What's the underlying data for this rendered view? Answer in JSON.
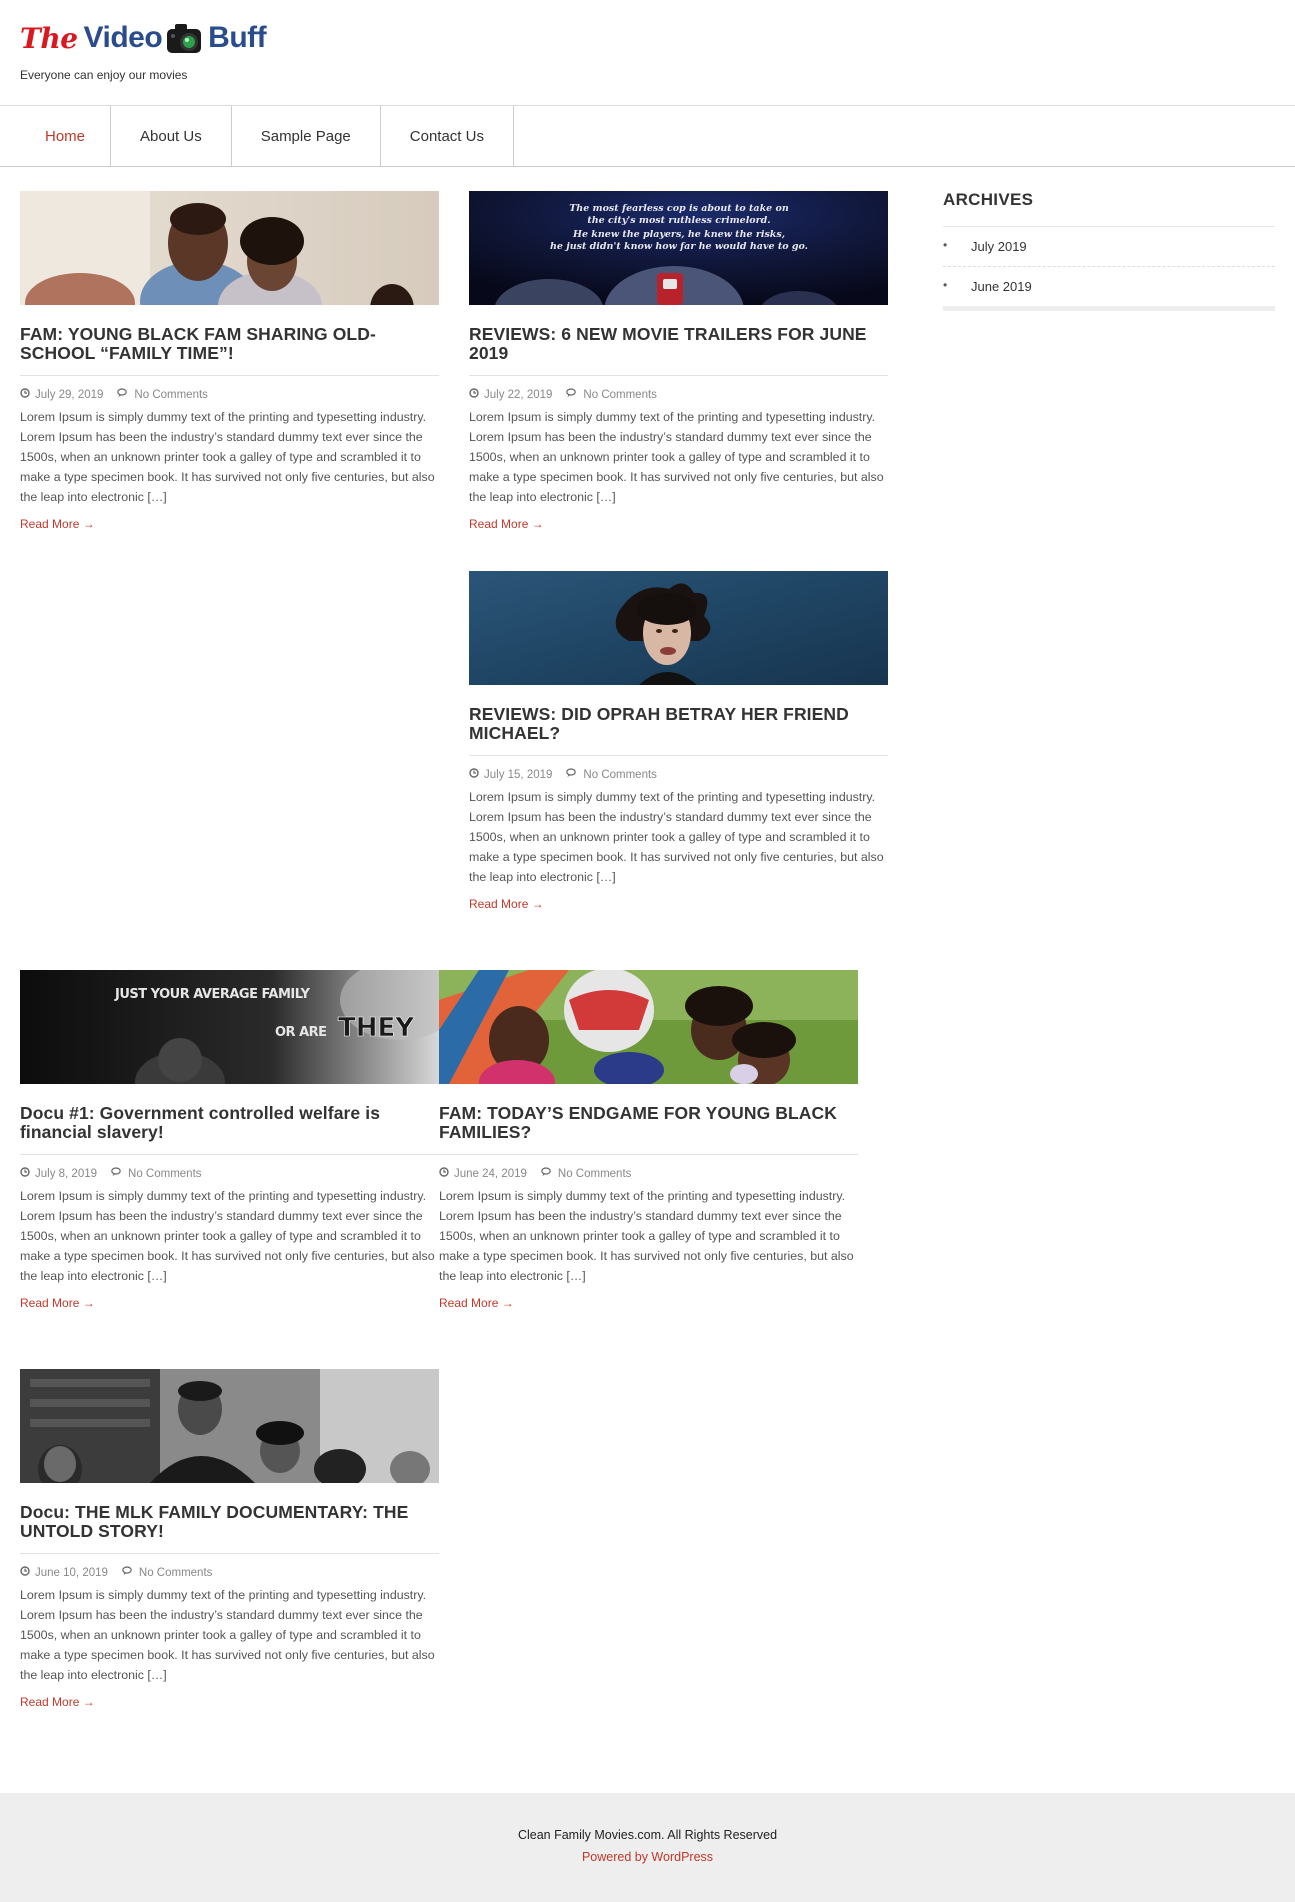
{
  "site": {
    "logo_the": "The",
    "logo_video": "Video",
    "logo_buff": "Buff",
    "tagline": "Everyone can enjoy our movies"
  },
  "nav": {
    "items": [
      {
        "label": "Home"
      },
      {
        "label": "About Us"
      },
      {
        "label": "Sample Page"
      },
      {
        "label": "Contact Us"
      }
    ]
  },
  "posts": [
    {
      "title": "FAM: YOUNG BLACK FAM SHARING OLD-SCHOOL “FAMILY TIME”!",
      "date": "July 29, 2019",
      "comments": "No Comments",
      "excerpt": "Lorem Ipsum is simply dummy text of the printing and typesetting industry. Lorem Ipsum has been the industry’s standard dummy text ever since the 1500s, when an unknown printer took a galley of type and scrambled it to make a type specimen book. It has survived not only five centuries, but also the leap into electronic […]",
      "read_more": "Read More →"
    },
    {
      "title": "REVIEWS: 6 NEW MOVIE TRAILERS FOR JUNE 2019",
      "date": "July 22, 2019",
      "comments": "No Comments",
      "excerpt": "Lorem Ipsum is simply dummy text of the printing and typesetting industry. Lorem Ipsum has been the industry’s standard dummy text ever since the 1500s, when an unknown printer took a galley of type and scrambled it to make a type specimen book. It has survived not only five centuries, but also the leap into electronic […]",
      "read_more": "Read More →",
      "thumb_text": [
        "The most fearless cop is about to take on",
        "the city's most ruthless crimelord.",
        "He knew the players, he knew the risks,",
        "he just didn't know how far he would have to go."
      ]
    },
    {
      "title": "REVIEWS: DID OPRAH BETRAY HER FRIEND MICHAEL?",
      "date": "July 15, 2019",
      "comments": "No Comments",
      "excerpt": "Lorem Ipsum is simply dummy text of the printing and typesetting industry. Lorem Ipsum has been the industry’s standard dummy text ever since the 1500s, when an unknown printer took a galley of type and scrambled it to make a type specimen book. It has survived not only five centuries, but also the leap into electronic […]",
      "read_more": "Read More →"
    },
    {
      "title": "Docu #1: Government controlled welfare is financial slavery!",
      "date": "July 8, 2019",
      "comments": "No Comments",
      "excerpt": "Lorem Ipsum is simply dummy text of the printing and typesetting industry. Lorem Ipsum has been the industry’s standard dummy text ever since the 1500s, when an unknown printer took a galley of type and scrambled it to make a type specimen book. It has survived not only five centuries, but also the leap into electronic […]",
      "read_more": "Read More →",
      "thumb_text": [
        "JUST YOUR AVERAGE FAMILY",
        "OR ARE",
        "THEY"
      ]
    },
    {
      "title": "FAM: TODAY’S ENDGAME FOR YOUNG BLACK FAMILIES?",
      "date": "June 24, 2019",
      "comments": "No Comments",
      "excerpt": "Lorem Ipsum is simply dummy text of the printing and typesetting industry. Lorem Ipsum has been the industry’s standard dummy text ever since the 1500s, when an unknown printer took a galley of type and scrambled it to make a type specimen book. It has survived not only five centuries, but also the leap into electronic […]",
      "read_more": "Read More →"
    },
    {
      "title": "Docu: THE MLK FAMILY DOCUMENTARY: THE UNTOLD STORY!",
      "date": "June 10, 2019",
      "comments": "No Comments",
      "excerpt": "Lorem Ipsum is simply dummy text of the printing and typesetting industry. Lorem Ipsum has been the industry’s standard dummy text ever since the 1500s, when an unknown printer took a galley of type and scrambled it to make a type specimen book. It has survived not only five centuries, but also the leap into electronic […]",
      "read_more": "Read More →"
    }
  ],
  "sidebar": {
    "archives_title": "ARCHIVES",
    "archives": [
      {
        "label": "July 2019"
      },
      {
        "label": "June 2019"
      }
    ]
  },
  "footer": {
    "copyright": "Clean Family Movies.com. All Rights Reserved",
    "powered": "Powered by WordPress"
  },
  "colors": {
    "accent": "#c0392b",
    "logo_blue": "#2b4c8c",
    "logo_red": "#d9181f"
  }
}
